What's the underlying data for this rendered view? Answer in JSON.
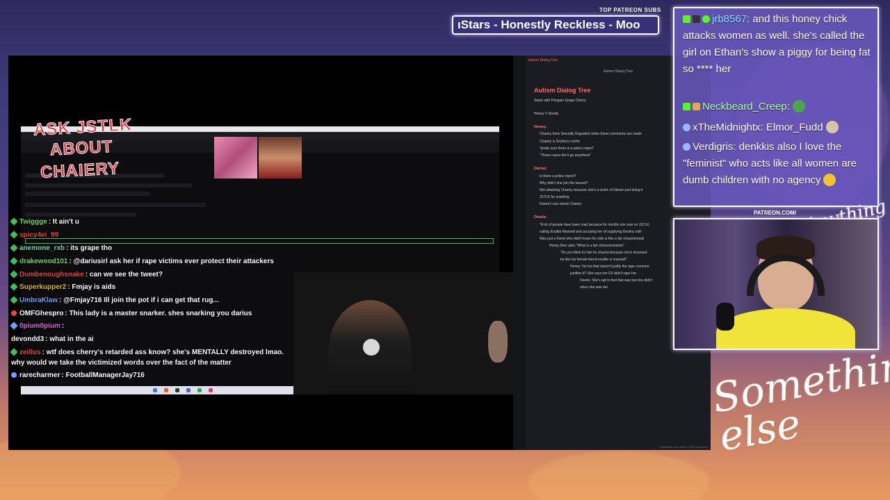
{
  "overlay": {
    "patreon_label": "TOP PATREON SUBS",
    "patreon_ticker": "ıStars - Honestly Reckless - Moo",
    "patreon_url": "PATREON.COM/",
    "signature_small": "Anything Else",
    "signature_big": "Something else"
  },
  "stream": {
    "overlay_lines": [
      "ASK JSTLK",
      "ABOUT",
      "CHAIERY"
    ],
    "chat": [
      {
        "user": "Twiggge",
        "text": ": It ain't u",
        "color": "#6bdc5a"
      },
      {
        "user": "spicy4ei_99",
        "text": "",
        "color": "#e54545"
      },
      {
        "user": "anemone_rxb",
        "text": ": its grape tho",
        "color": "#63d8b2"
      },
      {
        "user": "drakewood101",
        "text": ": @dariusirl ask her if rape victims ever protect their attackers",
        "color": "#69d86a"
      },
      {
        "user": "Dumbenoughsnake",
        "text": ": can we see the tweet?",
        "color": "#e54545"
      },
      {
        "user": "Superkupper2",
        "text": ": Fmjay is aids",
        "color": "#e0b430"
      },
      {
        "user": "UmbraKlaw",
        "text": ": @Fmjay716 Ill join the pot if i can get that rug...",
        "color": "#6aa2ff"
      },
      {
        "user": "OMFGhespro",
        "text": ": This lady is a master snarker. shes snarking you darius",
        "color": "#ffffff"
      },
      {
        "user": "0pium0pium",
        "text": ":",
        "color": "#d66bd6"
      },
      {
        "user": "devondd3",
        "text": ": what in the ai",
        "color": "#ffffff"
      },
      {
        "user": "zeillus",
        "text": ": wtf does cherry's retarded ass know? she's MENTALLY destroyed lmao.",
        "color": "#e54545"
      },
      {
        "user": "",
        "text": "why would we take the victimized words over the fact of the matter",
        "color": "#ffffff"
      },
      {
        "user": "rarecharmer",
        "text": ": FootballManagerJay716",
        "color": "#ffffff"
      }
    ]
  },
  "notes": {
    "tab": "Autism Dialog Tree",
    "crumb": "Autism Dialog Tree",
    "title": "Autism Dialog Tree",
    "intro": [
      "Starts with Penguin Grape Cherry",
      "Honey V Deeds"
    ],
    "honey_head": "Honey:",
    "honey": [
      "Chaeiry feels Sexually Degraded when these comments are made",
      "Chaeiry is Destiny's victim",
      "\"pretty sure there is a police report\"",
      "\"Those cases don't go anywhere\""
    ],
    "darius_head": "Darius:",
    "darius": [
      "Is there a police report?",
      "Why didn't she join the lawsuit?",
      "Not attacking Chaeiry because she's a victim of Steven just doing it",
      "JSTLK for snarking",
      "Doesn't care about Chaeiry"
    ],
    "deeds_head": "Deeds:",
    "deeds": [
      "\"A lot of people have been mad because for months she was on JSTLK",
      "calling Erudite Maxwell and accusing her of supplying Destiny with",
      "Was just a friend who didn't leave his side is this a fair characterizati",
      "Honey then asks \"What is a fair characterization\"",
      "\"Do you think it's fair for chaeiry because she's incensed",
      "be like his female friend erudite is maxwell\"",
      "Honey: No but that doesn't justify the rape commen",
      "justifies it? She says her EX didn't rape her.",
      "Deeds: She's apt to feel that way but she didn't",
      "when she was dei"
    ],
    "status": "0 backlinks   181 words   1,067 characters"
  },
  "chat_overlay": {
    "messages": [
      {
        "user": "jrb8567",
        "text": ": and this honey chick attacks women as well. she's called the girl on Ethan's show a piggy for being fat so **** her",
        "color": "#7de0ff"
      },
      {
        "user": "Neckbeard_Creep",
        "text": ":",
        "color": "#a8ff9a"
      },
      {
        "user": "xTheMidnightx",
        "text": ": Elmor_Fudd",
        "color": "#ffffff"
      },
      {
        "user": "Verdigris",
        "text": ": denkkis also I love the \"feminist\" who acts like all women are dumb children with no agency",
        "color": "#ffffff"
      }
    ]
  }
}
